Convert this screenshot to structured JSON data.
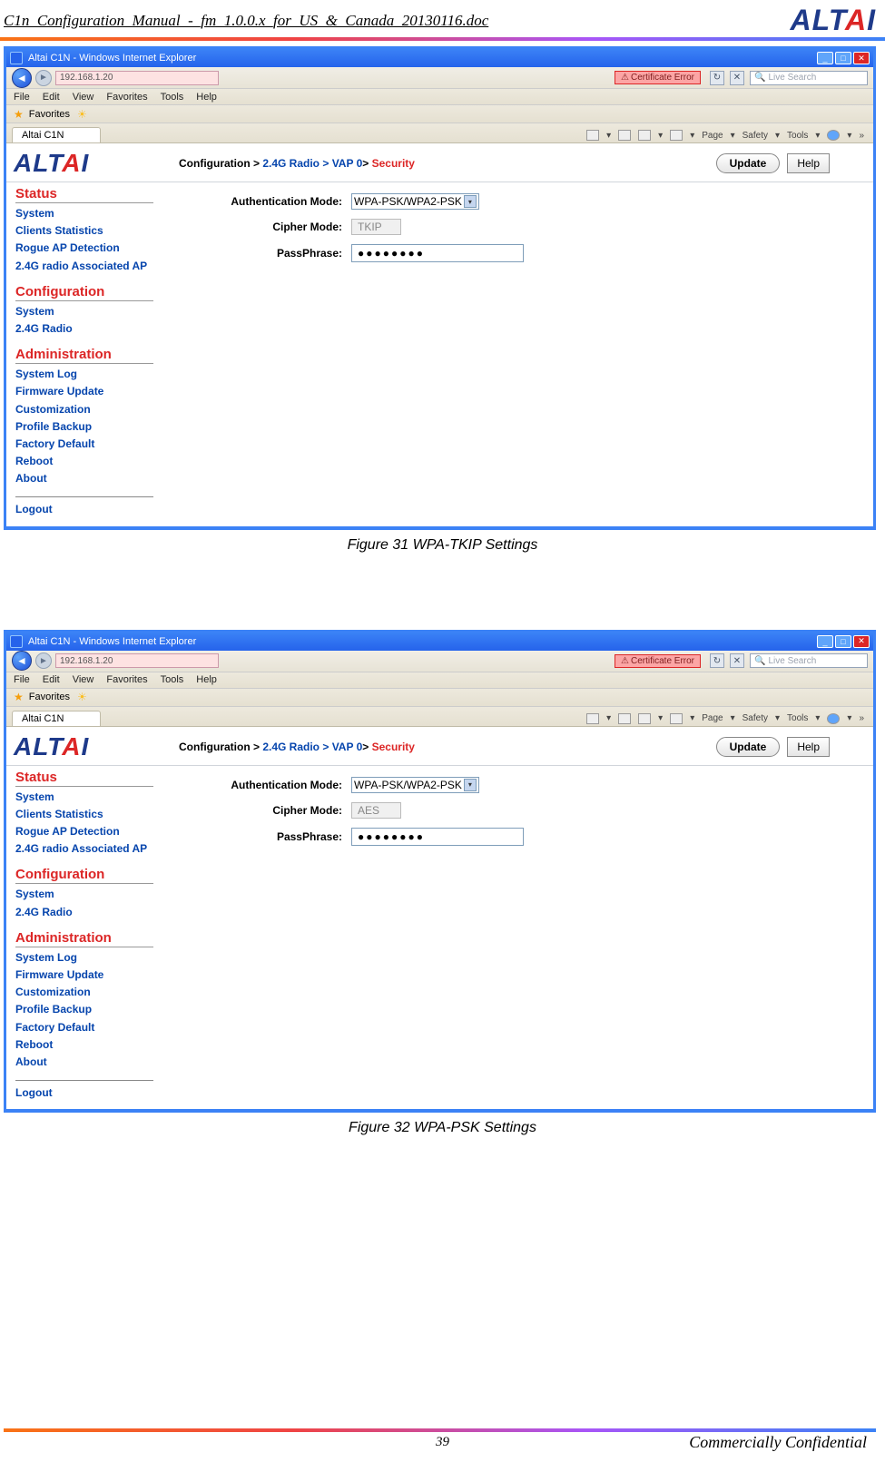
{
  "doc_title": "C1n_Configuration_Manual_-_fm_1.0.0.x_for_US_&_Canada_20130116.doc",
  "logo_text_a": "ALT",
  "logo_slash": "A",
  "logo_text_b": "I",
  "ie": {
    "title": "Altai C1N - Windows Internet Explorer",
    "addr": "192.168.1.20",
    "cert_error": "Certificate Error",
    "search_placeholder": "Live Search",
    "menu": {
      "file": "File",
      "edit": "Edit",
      "view": "View",
      "fav": "Favorites",
      "tools": "Tools",
      "help": "Help"
    },
    "favorites_label": "Favorites",
    "tab_label": "Altai C1N",
    "toolstrip": {
      "page": "Page",
      "safety": "Safety",
      "tools": "Tools"
    }
  },
  "web": {
    "logo_alt": "ALT",
    "logo_a": "A",
    "logo_i": "I",
    "breadcrumb": {
      "conf": "Configuration > ",
      "radio": "2.4G Radio > ",
      "vap": "VAP 0",
      "gt": "> ",
      "sec": "Security"
    },
    "btn_update": "Update",
    "btn_help": "Help",
    "side": {
      "status_title": "Status",
      "status_links": [
        "System",
        "Clients Statistics",
        "Rogue AP Detection",
        "2.4G radio Associated AP"
      ],
      "config_title": "Configuration",
      "config_links": [
        "System",
        "2.4G Radio"
      ],
      "admin_title": "Administration",
      "admin_links": [
        "System Log",
        "Firmware Update",
        "Customization",
        "Profile Backup",
        "Factory Default",
        "Reboot",
        "About"
      ],
      "logout": "Logout"
    },
    "form": {
      "auth_label": "Authentication Mode:",
      "auth_value": "WPA-PSK/WPA2-PSK",
      "cipher_label": "Cipher Mode:",
      "pass_label": "PassPhrase:",
      "pass_dots": "●●●●●●●●"
    },
    "cipher_tkip": "TKIP",
    "cipher_aes": "AES"
  },
  "captions": {
    "fig31": "Figure 31    WPA-TKIP Settings",
    "fig32": "Figure 32    WPA-PSK Settings"
  },
  "footer": {
    "page_num": "39",
    "conf": "Commercially Confidential"
  }
}
